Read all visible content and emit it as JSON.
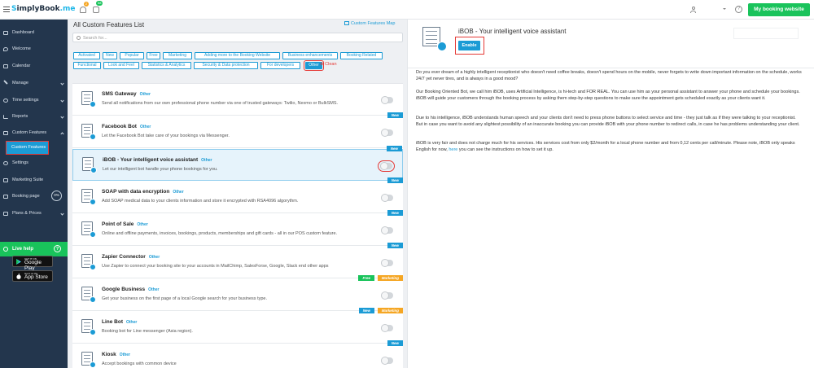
{
  "topbar": {
    "logo_main": "implyBook",
    "logo_s": "S",
    "logo_me": ".me",
    "notif_count": "2",
    "tasks_count": "58",
    "help_glyph": "?",
    "my_website_label": "My booking website",
    "accent": "#19c35b"
  },
  "sidebar": {
    "items": [
      {
        "label": "Dashboard",
        "icon": "dashboard-icon"
      },
      {
        "label": "Welcome",
        "icon": "pin-icon"
      },
      {
        "label": "Calendar",
        "icon": "calendar-icon"
      },
      {
        "label": "Manage",
        "icon": "pencil-icon"
      },
      {
        "label": "Time settings",
        "icon": "clock-icon"
      },
      {
        "label": "Reports",
        "icon": "chart-icon"
      },
      {
        "label": "Custom Features",
        "icon": "puzzle-icon"
      },
      {
        "label": "Settings",
        "icon": "gear-icon"
      },
      {
        "label": "Marketing Suite",
        "icon": "megaphone-icon"
      },
      {
        "label": "Booking page",
        "icon": "thumb-icon"
      },
      {
        "label": "Plans & Prices",
        "icon": "card-icon"
      }
    ],
    "sub_active": "Custom Features",
    "booking_page_pct": "0%",
    "live_help": "Live help",
    "live_help_q": "?",
    "stores": {
      "google_small": "GET IT ON",
      "google_big": "Google Play",
      "apple_small": "Get it on the",
      "apple_big": "App Store"
    },
    "bg": "#23364d"
  },
  "main": {
    "title": "All Custom Features List",
    "map_link": "Custom Features Map",
    "search_placeholder": "Search for...",
    "tags": [
      "Activated",
      "New",
      "Popular",
      "Free",
      "Marketing",
      "Adding more to the Booking Website",
      "Business enhancements",
      "Booking Related",
      "Functional",
      "Look and Feel",
      "Statistics & Analytics",
      "Security & Data protection",
      "For developers",
      "Other"
    ],
    "clean_label": "Clean",
    "badges": {
      "new": "New",
      "free": "Free",
      "marketing": "Marketing"
    },
    "items": [
      {
        "name": "SMS Gateway",
        "cat": "Other",
        "desc": "Send all notifications from our own professional phone number via one of trusted gateways: Twilio, Nexmo or BulkSMS.",
        "badges": []
      },
      {
        "name": "Facebook Bot",
        "cat": "Other",
        "desc": "Let the Facebook Bot take care of your bookings via Messenger.",
        "badges": [
          "new"
        ]
      },
      {
        "name": "iBOB - Your intelligent voice assistant",
        "cat": "Other",
        "desc": "Let our intelligent bot handle your phone bookings for you.",
        "badges": [
          "new"
        ]
      },
      {
        "name": "SOAP with data encryption",
        "cat": "Other",
        "desc": "Add SOAP medical data to your clients information and store it encrypted with RSA4096 algorythm.",
        "badges": [
          "new"
        ]
      },
      {
        "name": "Point of Sale",
        "cat": "Other",
        "desc": "Online and offline payments, invoices, bookings, products, memberships and gift cards - all in our POS custom feature.",
        "badges": [
          "new"
        ]
      },
      {
        "name": "Zapier Connector",
        "cat": "Other",
        "desc": "Use Zapier to connect your booking site to your accounts in MailChimp, SalesForse, Google, Slack end other apps",
        "badges": [
          "new"
        ]
      },
      {
        "name": "Google Business",
        "cat": "Other",
        "desc": "Get your business on the first page of a local Google search for your business type.",
        "badges": [
          "free",
          "marketing"
        ]
      },
      {
        "name": "Line Bot",
        "cat": "Other",
        "desc": "Booking bot for Line messenger (Asia region).",
        "badges": [
          "new",
          "marketing"
        ]
      },
      {
        "name": "Kiosk",
        "cat": "Other",
        "desc": "Accept bookings with common device",
        "badges": [
          "new"
        ]
      }
    ]
  },
  "detail": {
    "title": "iBOB - Your intelligent voice assistant",
    "enable_label": "Enable",
    "p1": "Do you ever dream of a highly intelligent receptionist who doesn't need coffee breaks, doesn't spend hours on the mobile, never forgets to write down important information on the schedule, works 24/7 yet never tires, and is always in a good mood?",
    "p2": "Our Booking Oriented Bot, we call him iBOB, uses Artificial Intelligence, is hi-tech and FOR REAL. You can use him as your personal assistant to answer your phone and schedule your bookings. iBOB will guide your customers through the booking process by asking them step-by-step questions to make sure the appointment gets scheduled exactly as your clients want it.",
    "p3": "Due to his intelligence, iBOB understands human speech and your clients don't need to press phone buttons to select service and time - they just talk as if they were talking to your receptionist. But in case you want to avoid any slightest possibility of an inaccurate booking you can provide iBOB with your phone number to redirect calls, in case he has problems understanding your client.",
    "p4_a": "iBOB is very fair and does not charge much for his services. His services cost from only $2/month for a local phone number and from 0,12 cents per call/minute. Please note, iBOB only speaks English for now,",
    "p4_link": "here",
    "p4_b": "you can see the instructions on how to set it up."
  }
}
